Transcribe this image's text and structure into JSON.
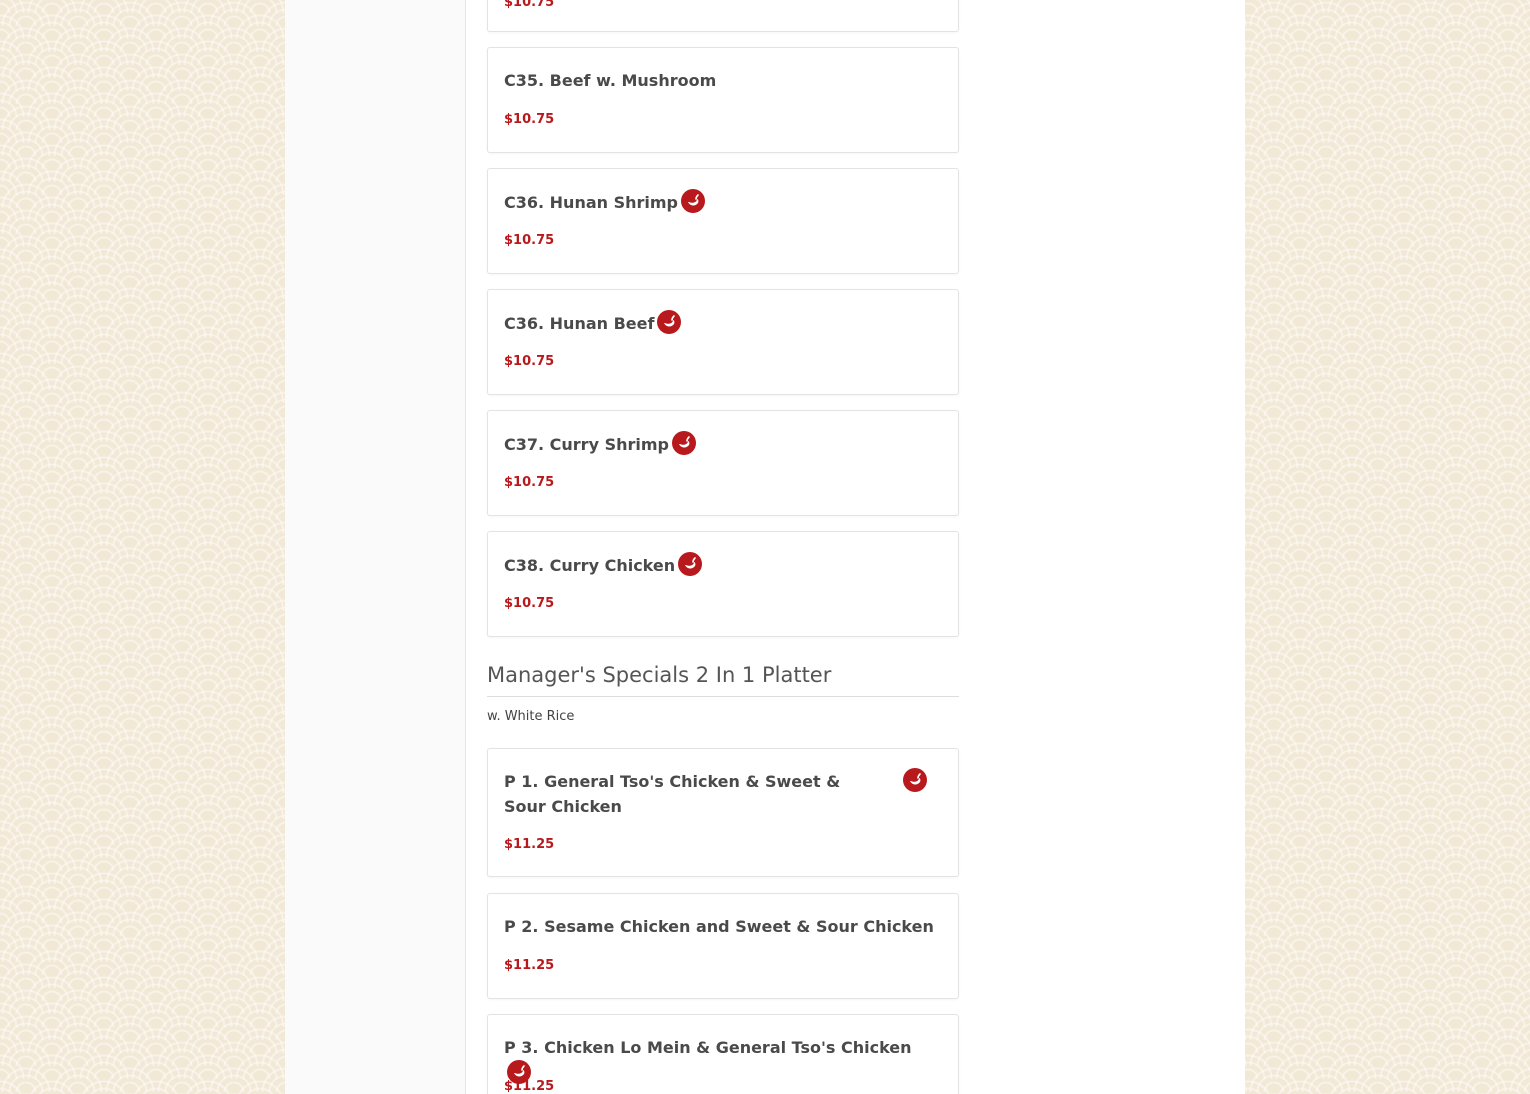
{
  "items_top": [
    {
      "name": "C35. Beef w. Mushroom",
      "price": "$10.75",
      "spicy": false
    },
    {
      "name": "C36. Hunan Shrimp",
      "price": "$10.75",
      "spicy": true
    },
    {
      "name": "C36. Hunan Beef",
      "price": "$10.75",
      "spicy": true
    },
    {
      "name": "C37. Curry Shrimp",
      "price": "$10.75",
      "spicy": true
    },
    {
      "name": "C38. Curry Chicken",
      "price": "$10.75",
      "spicy": true
    }
  ],
  "partial_top_price": "$10.75",
  "section": {
    "title": "Manager's Specials 2 In 1 Platter",
    "subtitle": "w. White Rice"
  },
  "items_section": [
    {
      "name": "P 1. General Tso's Chicken & Sweet & Sour Chicken",
      "price": "$11.25",
      "spicy": true
    },
    {
      "name": "P 2. Sesame Chicken and Sweet & Sour Chicken",
      "price": "$11.25",
      "spicy": false
    },
    {
      "name": "P 3. Chicken Lo Mein & General Tso's Chicken",
      "price": "$11.25",
      "spicy": true
    }
  ],
  "icons": {
    "spicy": "chili-pepper-icon"
  },
  "colors": {
    "price": "#b8191c",
    "pepper_bg": "#b8191c"
  }
}
